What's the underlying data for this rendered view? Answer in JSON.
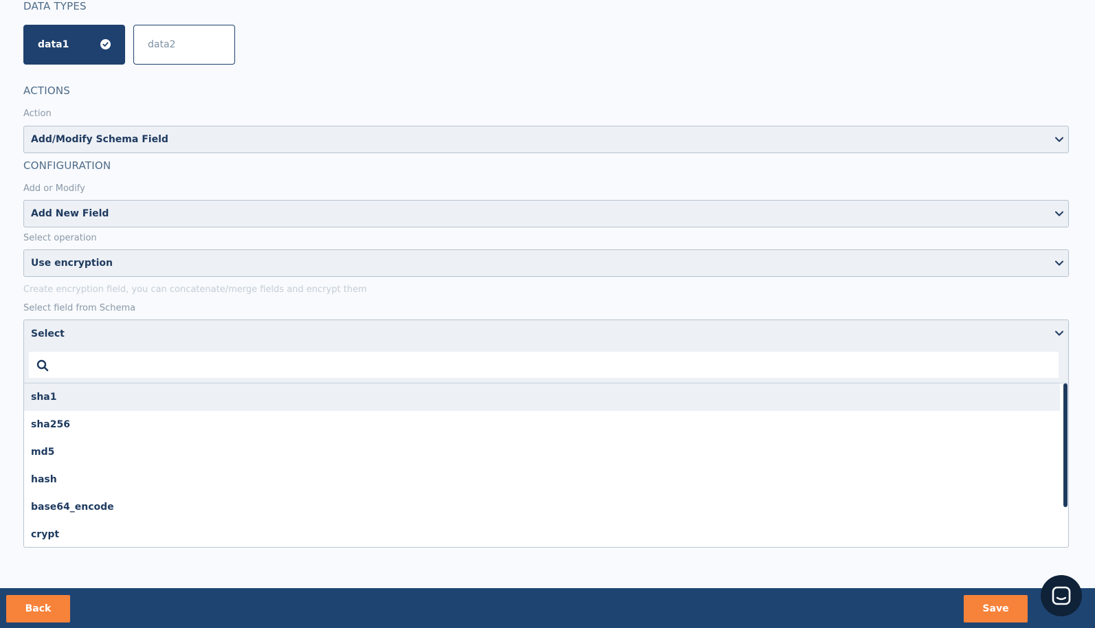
{
  "data_types": {
    "title": "DATA TYPES",
    "items": [
      {
        "label": "data1",
        "selected": true
      },
      {
        "label": "data2",
        "selected": false
      }
    ]
  },
  "actions": {
    "title": "ACTIONS",
    "action_label": "Action",
    "action_value": "Add/Modify Schema Field"
  },
  "configuration": {
    "title": "CONFIGURATION",
    "add_modify_label": "Add or Modify",
    "add_modify_value": "Add New Field",
    "operation_label": "Select operation",
    "operation_value": "Use encryption",
    "hint": "Create encryption field, you can concatenate/merge fields and encrypt them",
    "schema_field_label": "Select field from Schema",
    "schema_field_value": "Select",
    "search_value": "",
    "options": [
      "sha1",
      "sha256",
      "md5",
      "hash",
      "base64_encode",
      "crypt"
    ]
  },
  "footer": {
    "back_label": "Back",
    "save_label": "Save"
  },
  "colors": {
    "primary": "#1e416f",
    "accent": "#f7823a",
    "footer": "#1e4472"
  }
}
